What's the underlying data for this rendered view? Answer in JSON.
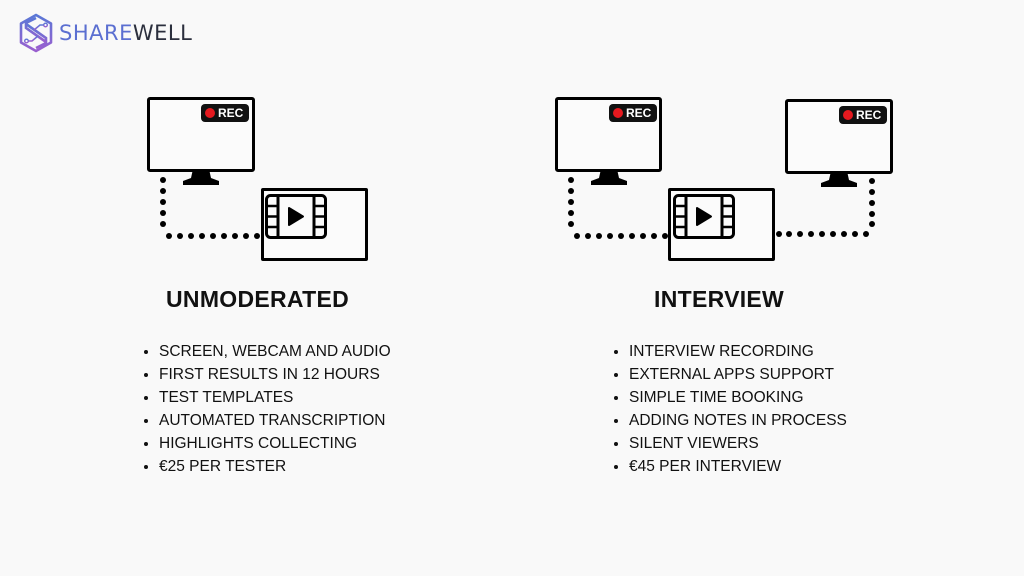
{
  "brand": {
    "name_part1": "SHARE",
    "name_part2": "WELL",
    "icon": "sharewell-logo-icon",
    "colors": {
      "blue": "#5b6fd1",
      "purple": "#8e6ad0",
      "dark": "#2b2f3d"
    }
  },
  "rec_label": "REC",
  "rec_color": "#e5191f",
  "plans": [
    {
      "title": "UNMODERATED",
      "features": [
        "SCREEN, WEBCAM AND AUDIO",
        "FIRST RESULTS IN 12 HOURS",
        "TEST TEMPLATES",
        "AUTOMATED TRANSCRIPTION",
        "HIGHLIGHTS COLLECTING",
        "€25 PER TESTER"
      ]
    },
    {
      "title": "INTERVIEW",
      "features": [
        "INTERVIEW RECORDING",
        "EXTERNAL APPS SUPPORT",
        "SIMPLE TIME BOOKING",
        "ADDING NOTES IN PROCESS",
        "SILENT VIEWERS",
        "€45 PER INTERVIEW"
      ]
    }
  ]
}
